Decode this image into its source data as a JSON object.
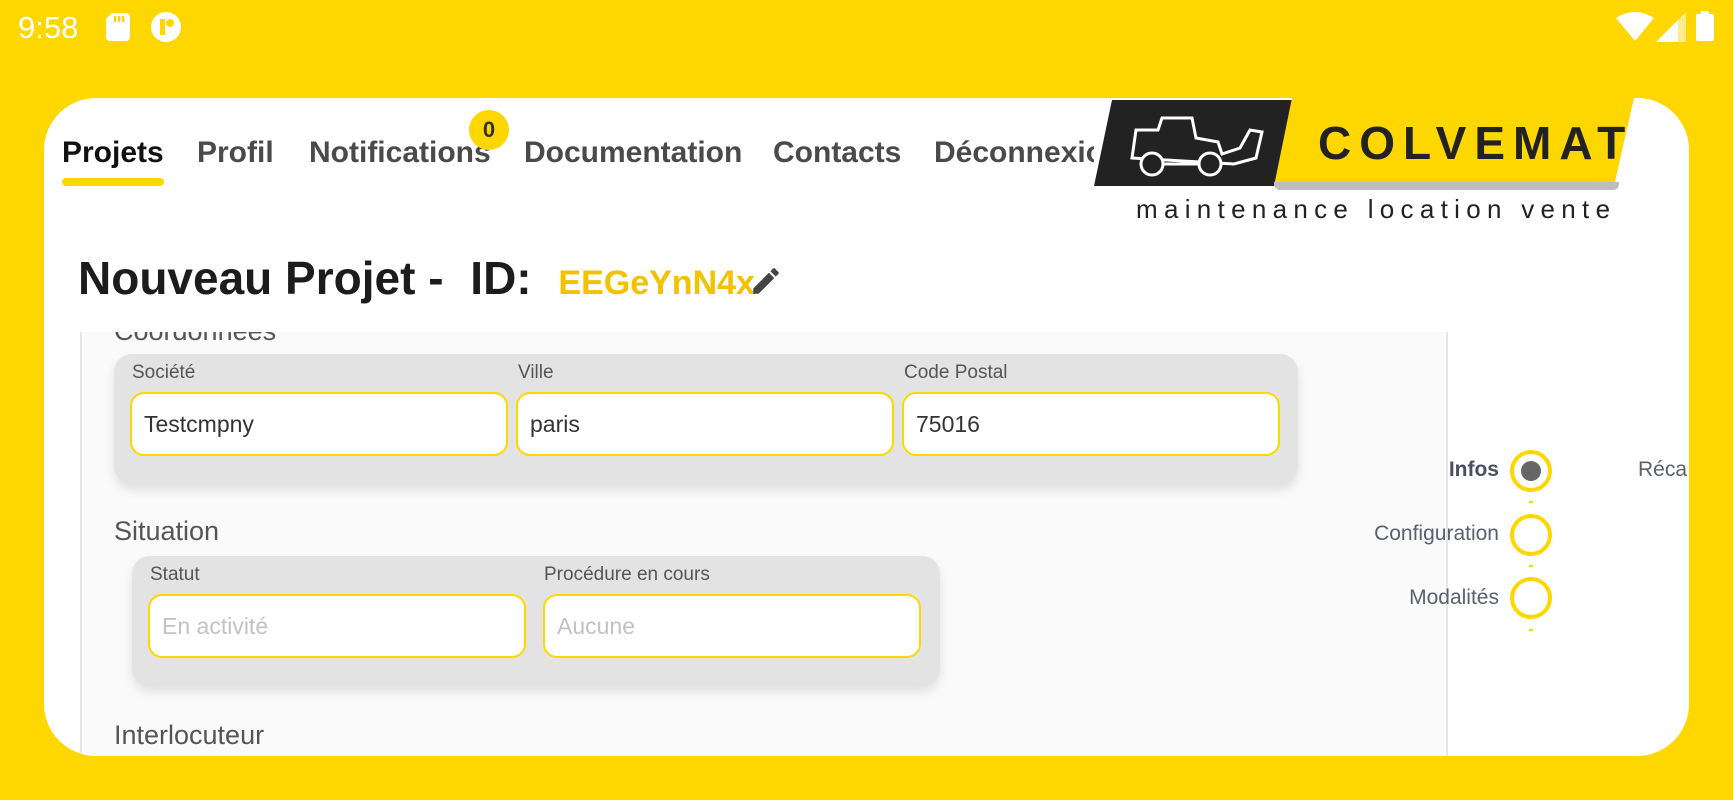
{
  "status_bar": {
    "time": "9:58",
    "icons": [
      "sd-card-icon",
      "app-notification-icon",
      "wifi-icon",
      "cell-signal-icon",
      "battery-icon"
    ]
  },
  "nav": {
    "tabs": [
      {
        "label": "Projets",
        "active": true
      },
      {
        "label": "Profil"
      },
      {
        "label": "Notifications",
        "badge": "0"
      },
      {
        "label": "Documentation"
      },
      {
        "label": "Contacts"
      },
      {
        "label": "Déconnexion"
      }
    ]
  },
  "logo": {
    "brand": "COLVEMAT",
    "tagline": "maintenance location vente"
  },
  "page": {
    "title": "Nouveau Projet -",
    "id_label": "ID:",
    "id_value": "EEGeYnN4x"
  },
  "form": {
    "coordonnees": {
      "title": "Coordonnées",
      "fields": [
        {
          "label": "Société",
          "value": "Testcmpny"
        },
        {
          "label": "Ville",
          "value": "paris"
        },
        {
          "label": "Code Postal",
          "value": "75016"
        }
      ]
    },
    "situation": {
      "title": "Situation",
      "fields": [
        {
          "label": "Statut",
          "placeholder": "En activité"
        },
        {
          "label": "Procédure en cours",
          "placeholder": "Aucune"
        }
      ]
    },
    "interlocuteur": {
      "title": "Interlocuteur"
    }
  },
  "stepper": {
    "steps": [
      {
        "label": "Infos",
        "active": true
      },
      {
        "label": "Configuration"
      },
      {
        "label": "Modalités"
      }
    ],
    "next_label": "Réca"
  },
  "colors": {
    "accent": "#FFD700",
    "id_text": "#F2C200",
    "card_bg": "#FFFFFF"
  }
}
